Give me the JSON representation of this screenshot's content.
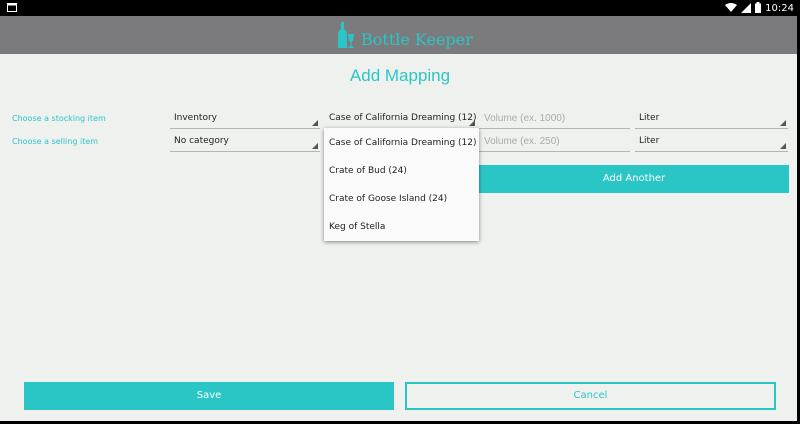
{
  "status_bar": {
    "time": "10:24",
    "icons": [
      "screenshot-icon",
      "wifi-icon",
      "signal-icon",
      "battery-icon"
    ]
  },
  "app": {
    "name": "Bottle Keeper",
    "logo_icon": "bottle-glass-icon"
  },
  "page": {
    "title": "Add Mapping"
  },
  "rows": {
    "stocking": {
      "label": "Choose a stocking item",
      "category": "Inventory",
      "item": "Case of California Dreaming (12)",
      "volume_placeholder": "Volume (ex. 1000)",
      "unit": "Liter"
    },
    "selling": {
      "label": "Choose a selling item",
      "category": "No category",
      "volume_placeholder": "Volume (ex. 250)",
      "unit": "Liter"
    }
  },
  "dropdown": {
    "options": [
      "Case of California Dreaming (12)",
      "Crate of Bud (24)",
      "Crate of Goose Island (24)",
      "Keg of Stella"
    ]
  },
  "buttons": {
    "add_another": "Add Another",
    "save": "Save",
    "cancel": "Cancel"
  },
  "colors": {
    "accent": "#2ac6c6",
    "appbar": "#7b7b7e",
    "background": "#eff1ef"
  }
}
